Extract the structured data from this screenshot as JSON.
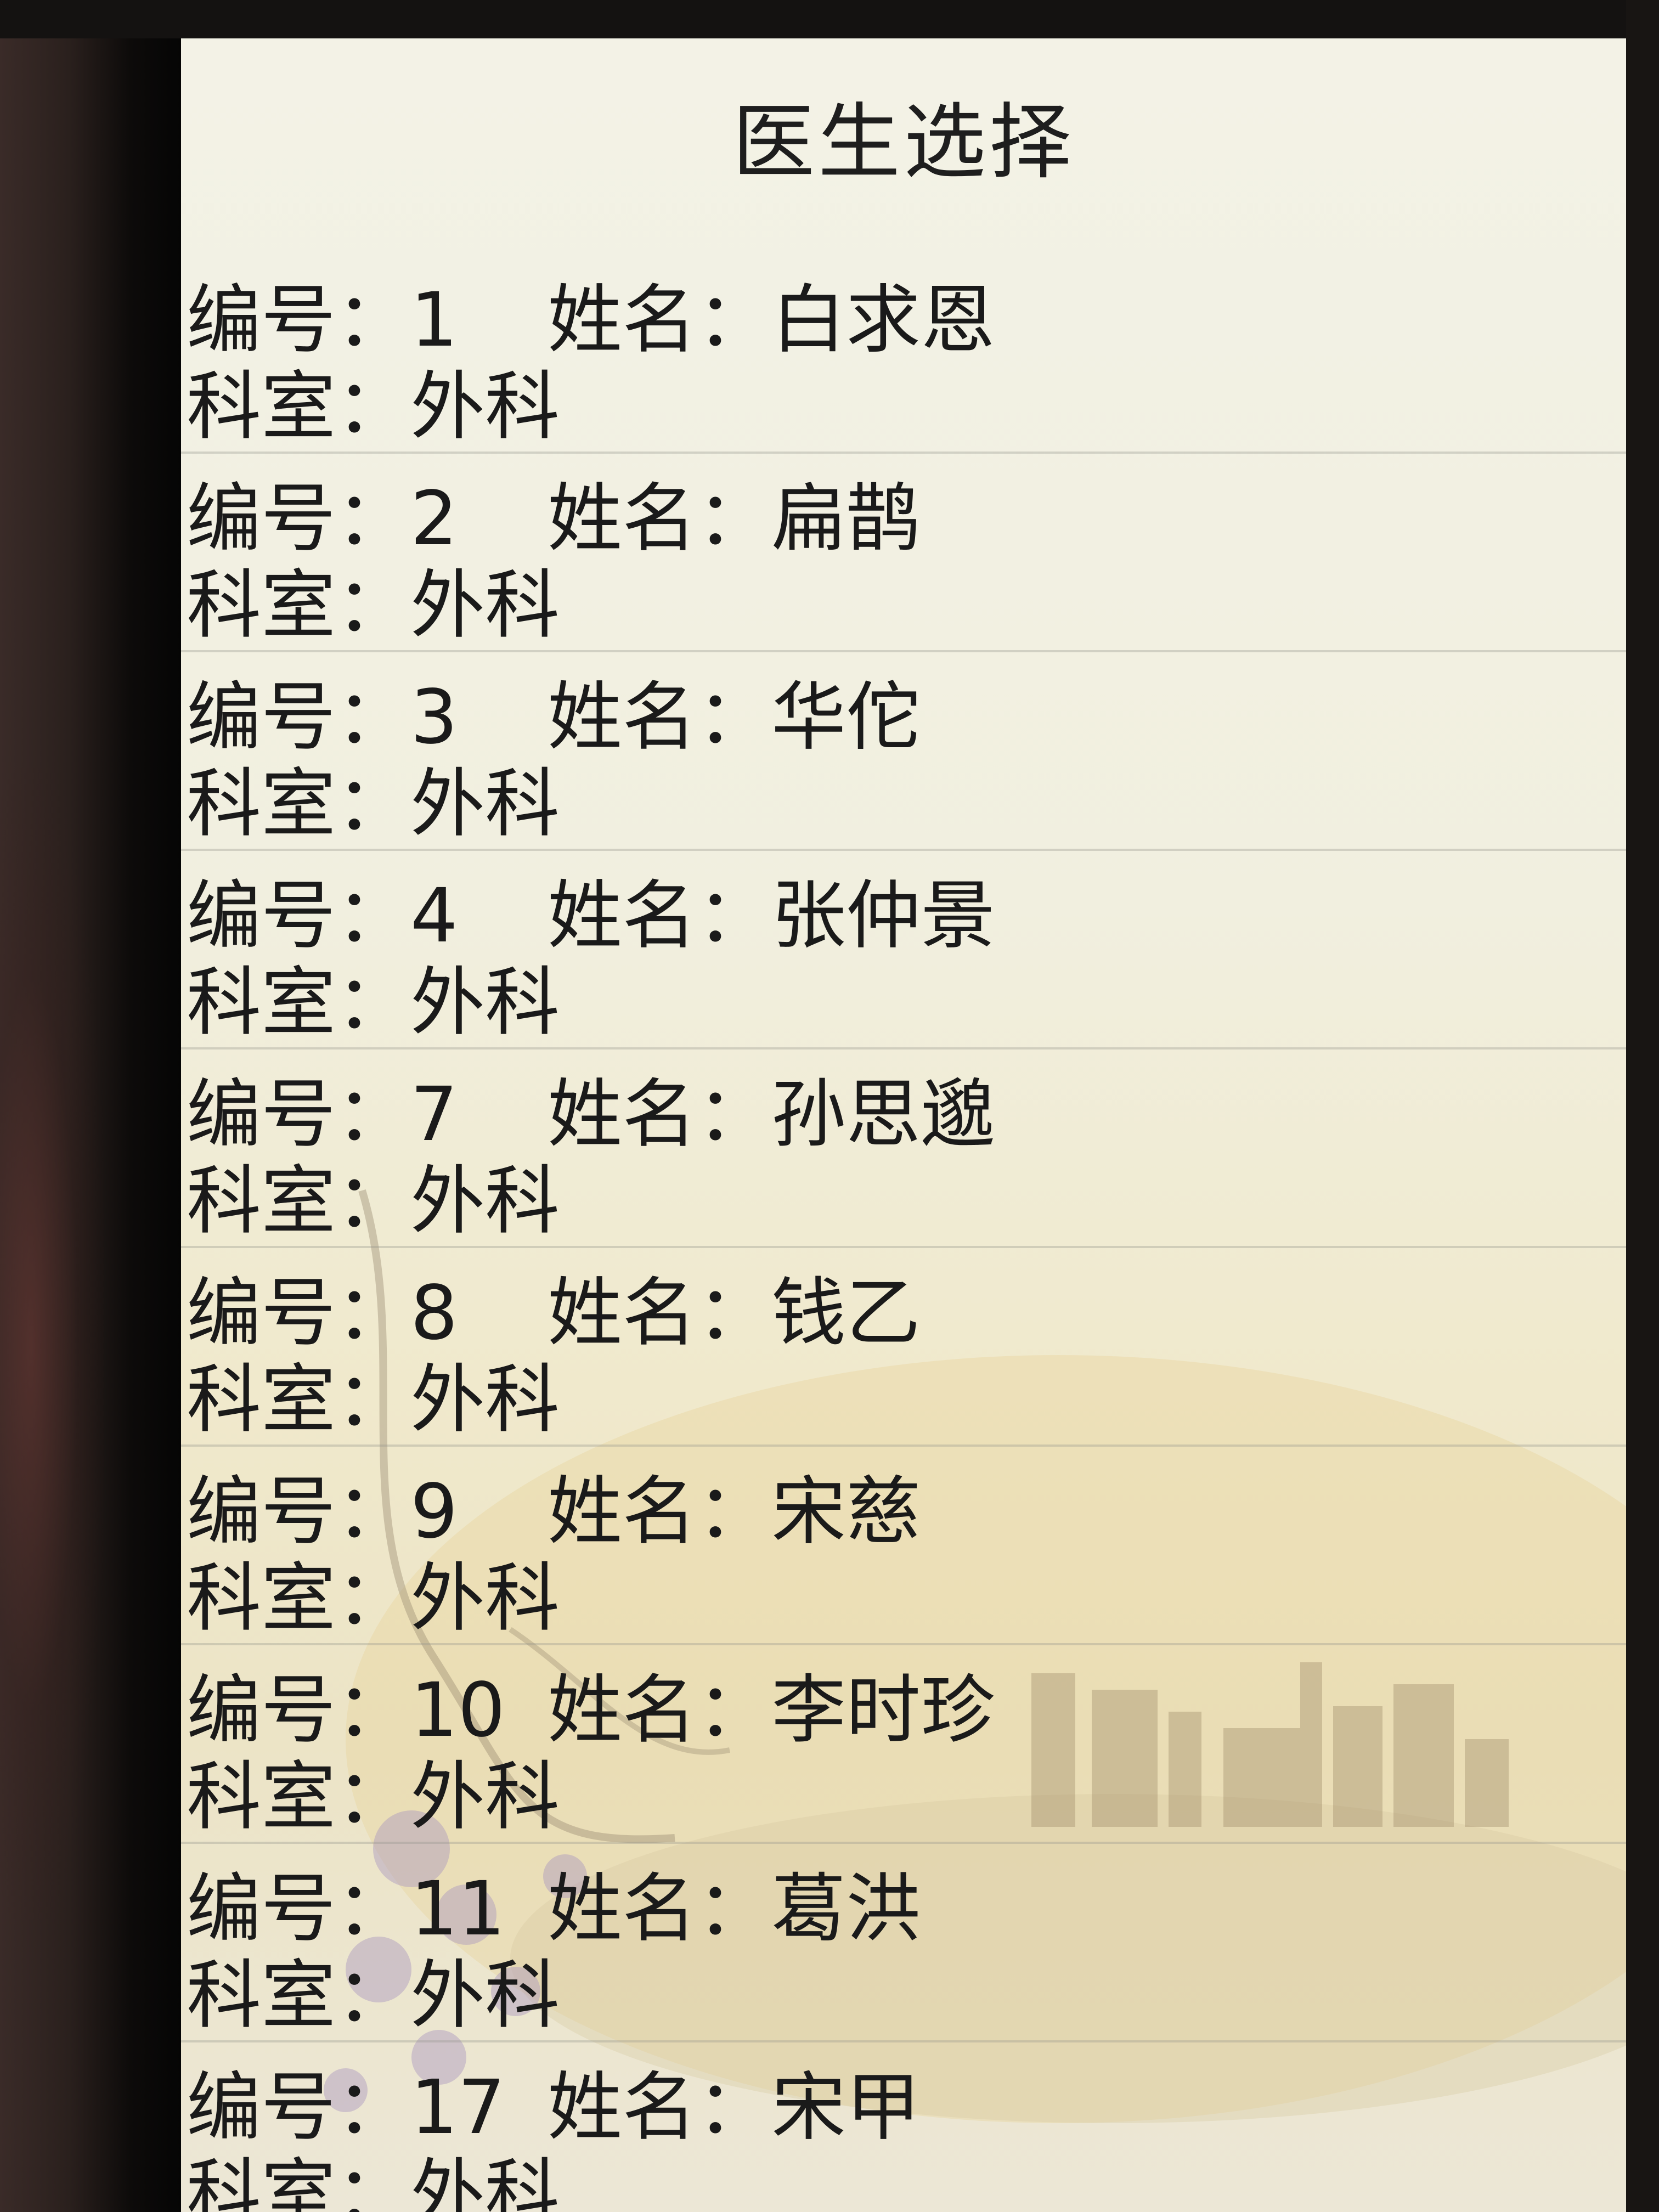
{
  "page_title": "医生选择",
  "labels": {
    "id": "编号：",
    "name": "姓名：",
    "department": "科室："
  },
  "doctors": [
    {
      "id": "1",
      "name": "白求恩",
      "department": "外科"
    },
    {
      "id": "2",
      "name": "扁鹊",
      "department": "外科"
    },
    {
      "id": "3",
      "name": "华佗",
      "department": "外科"
    },
    {
      "id": "4",
      "name": "张仲景",
      "department": "外科"
    },
    {
      "id": "7",
      "name": "孙思邈",
      "department": "外科"
    },
    {
      "id": "8",
      "name": "钱乙",
      "department": "外科"
    },
    {
      "id": "9",
      "name": "宋慈",
      "department": "外科"
    },
    {
      "id": "10",
      "name": "李时珍",
      "department": "外科"
    },
    {
      "id": "11",
      "name": "葛洪",
      "department": "外科"
    },
    {
      "id": "17",
      "name": "宋甲",
      "department": "外科"
    }
  ]
}
